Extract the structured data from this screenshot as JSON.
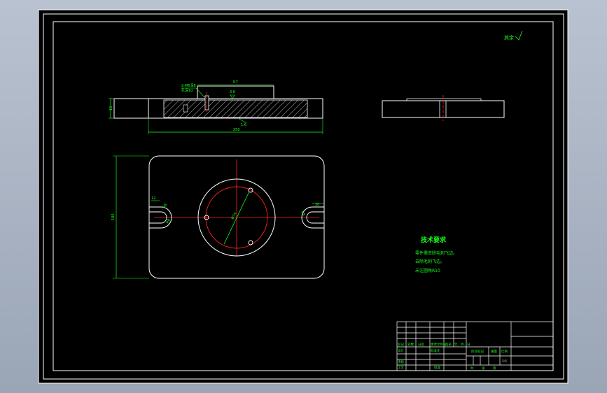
{
  "drawing": {
    "roughness_mark": "其余",
    "roughness_symbol": "▽",
    "top_view": {
      "left_dim_label": "16",
      "top_dim_label": "R7",
      "surface_symbol": "3.6",
      "note_line1": "2-M6深8",
      "note_line2": "孔深10",
      "bottom_dim1": "1:6",
      "bottom_dim2": "250"
    },
    "plan_view": {
      "height_dim": "180",
      "slot_width_left": "12",
      "slot_radius_left": "R8",
      "slot_width_right": "20",
      "slot_radius_right": "R8",
      "bolt_circle": "Ø74"
    },
    "tech_requirements": {
      "title": "技术要求",
      "lines": [
        "零件需去除毛刺飞边。",
        "去除毛刺飞边。",
        "未注圆角R10"
      ]
    },
    "title_block": {
      "cells": {
        "mark": "标记",
        "count": "处数",
        "zone": "分区",
        "change_doc": "更改文件号",
        "sign": "签名",
        "date": "年、月、日",
        "designer": "设计",
        "standardize": "标准化",
        "stage_mark": "阶段标记",
        "weight": "重量",
        "scale": "比例",
        "scale_value": "1:1",
        "review": "审核",
        "process": "工艺",
        "approve": "批准",
        "sheets": "共",
        "sheet_of": "张",
        "sheet_no": "第"
      }
    }
  }
}
